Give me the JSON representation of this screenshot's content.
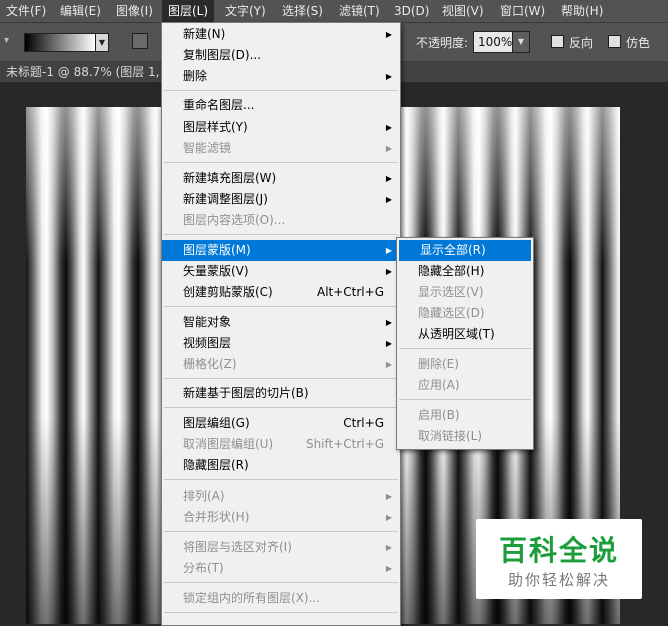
{
  "menubar": {
    "items": [
      "文件(F)",
      "编辑(E)",
      "图像(I)",
      "图层(L)",
      "文字(Y)",
      "选择(S)",
      "滤镜(T)",
      "3D(D)",
      "视图(V)",
      "窗口(W)",
      "帮助(H)"
    ],
    "active_index": 3
  },
  "options_bar": {
    "opacity_label": "不透明度:",
    "opacity_value": "100%",
    "reverse_label": "反向",
    "dither_label": "仿色"
  },
  "document_tab": {
    "title": "未标题-1 @ 88.7% (图层 1, I"
  },
  "layer_menu": {
    "items": [
      {
        "label": "新建(N)",
        "shortcut": "",
        "submenu": true,
        "disabled": false
      },
      {
        "label": "复制图层(D)...",
        "shortcut": "",
        "submenu": false,
        "disabled": false
      },
      {
        "label": "删除",
        "shortcut": "",
        "submenu": true,
        "disabled": false
      },
      {
        "label": "重命名图层...",
        "shortcut": "",
        "submenu": false,
        "disabled": false
      },
      {
        "label": "图层样式(Y)",
        "shortcut": "",
        "submenu": true,
        "disabled": false
      },
      {
        "label": "智能滤镜",
        "shortcut": "",
        "submenu": true,
        "disabled": true
      },
      {
        "label": "新建填充图层(W)",
        "shortcut": "",
        "submenu": true,
        "disabled": false
      },
      {
        "label": "新建调整图层(J)",
        "shortcut": "",
        "submenu": true,
        "disabled": false
      },
      {
        "label": "图层内容选项(O)...",
        "shortcut": "",
        "submenu": false,
        "disabled": true
      },
      {
        "label": "图层蒙版(M)",
        "shortcut": "",
        "submenu": true,
        "disabled": false,
        "highlighted": true
      },
      {
        "label": "矢量蒙版(V)",
        "shortcut": "",
        "submenu": true,
        "disabled": false
      },
      {
        "label": "创建剪贴蒙版(C)",
        "shortcut": "Alt+Ctrl+G",
        "submenu": false,
        "disabled": false
      },
      {
        "label": "智能对象",
        "shortcut": "",
        "submenu": true,
        "disabled": false
      },
      {
        "label": "视频图层",
        "shortcut": "",
        "submenu": true,
        "disabled": false
      },
      {
        "label": "栅格化(Z)",
        "shortcut": "",
        "submenu": true,
        "disabled": true
      },
      {
        "label": "新建基于图层的切片(B)",
        "shortcut": "",
        "submenu": false,
        "disabled": false
      },
      {
        "label": "图层编组(G)",
        "shortcut": "Ctrl+G",
        "submenu": false,
        "disabled": false
      },
      {
        "label": "取消图层编组(U)",
        "shortcut": "Shift+Ctrl+G",
        "submenu": false,
        "disabled": true
      },
      {
        "label": "隐藏图层(R)",
        "shortcut": "",
        "submenu": false,
        "disabled": false
      },
      {
        "label": "排列(A)",
        "shortcut": "",
        "submenu": true,
        "disabled": true
      },
      {
        "label": "合并形状(H)",
        "shortcut": "",
        "submenu": true,
        "disabled": true
      },
      {
        "label": "将图层与选区对齐(I)",
        "shortcut": "",
        "submenu": true,
        "disabled": true
      },
      {
        "label": "分布(T)",
        "shortcut": "",
        "submenu": true,
        "disabled": true
      },
      {
        "label": "锁定组内的所有图层(X)...",
        "shortcut": "",
        "submenu": false,
        "disabled": true
      }
    ]
  },
  "mask_submenu": {
    "items": [
      {
        "label": "显示全部(R)",
        "disabled": false,
        "highlighted": true
      },
      {
        "label": "隐藏全部(H)",
        "disabled": false
      },
      {
        "label": "显示选区(V)",
        "disabled": true
      },
      {
        "label": "隐藏选区(D)",
        "disabled": true
      },
      {
        "label": "从透明区域(T)",
        "disabled": false
      },
      {
        "label": "删除(E)",
        "disabled": true
      },
      {
        "label": "应用(A)",
        "disabled": true
      },
      {
        "label": "启用(B)",
        "disabled": true
      },
      {
        "label": "取消链接(L)",
        "disabled": true
      }
    ]
  },
  "watermark": {
    "title": "百科全说",
    "subtitle": "助你轻松解决"
  },
  "icons": {
    "submenu_arrow": "chevron-right-icon",
    "dropdown": "chevron-down-icon"
  },
  "colors": {
    "highlight": "#0078d7",
    "watermark_green": "#1a9d3a"
  }
}
